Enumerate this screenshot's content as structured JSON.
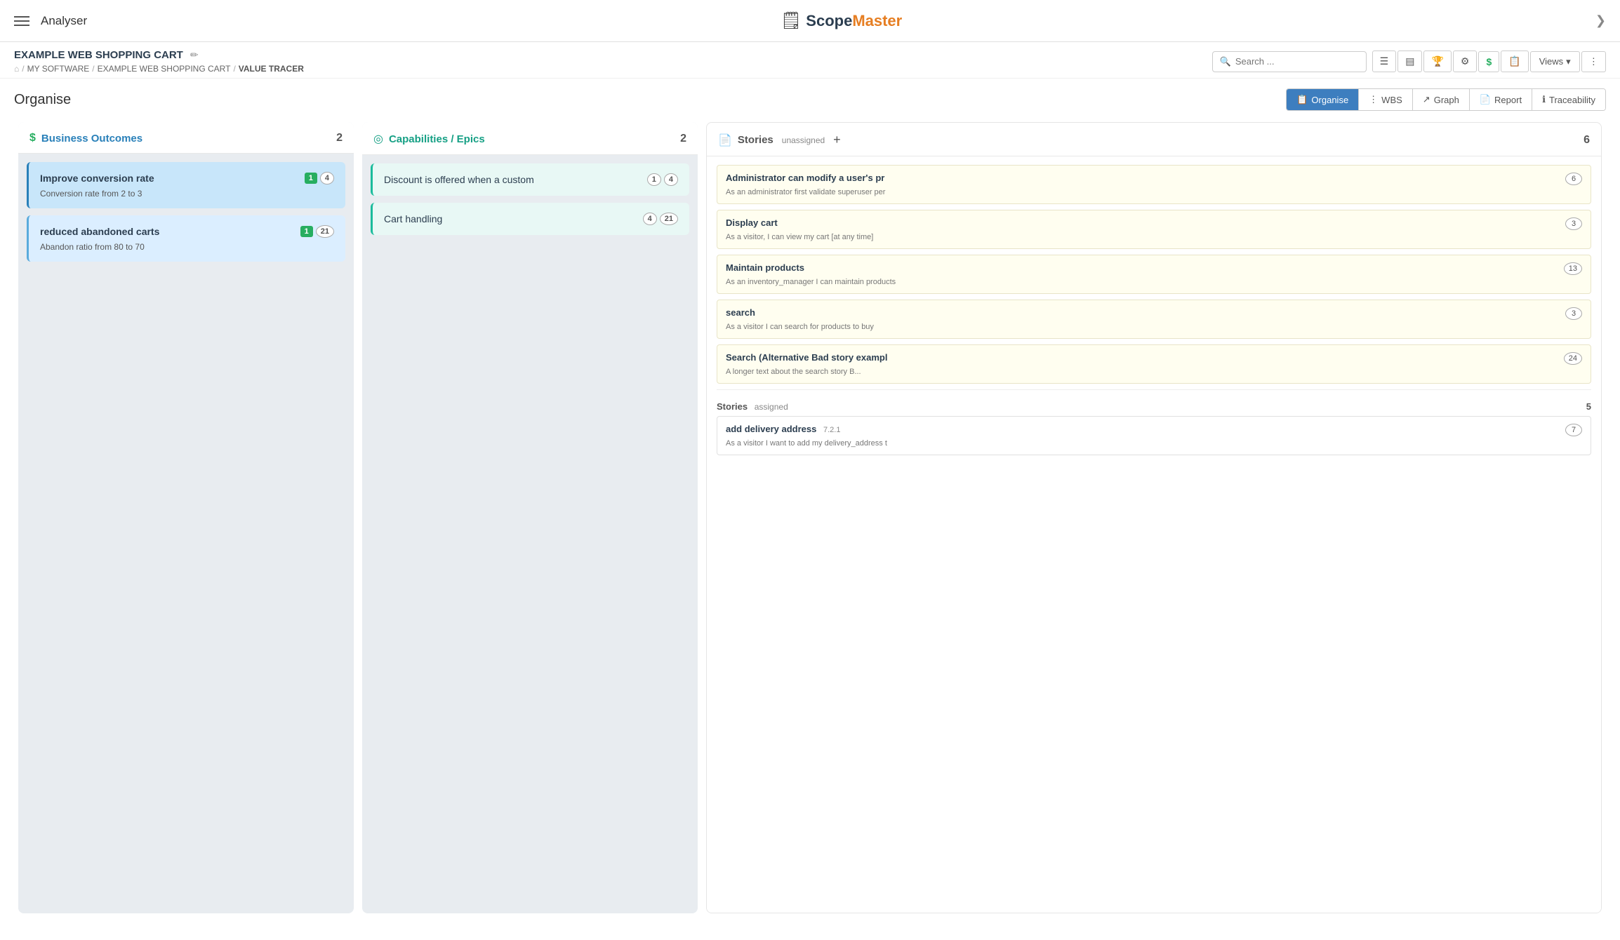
{
  "nav": {
    "hamburger_label": "Menu",
    "analyser_label": "Analyser",
    "brand": "ScopeMaster",
    "brand_prefix": "Scope",
    "brand_suffix": "Master",
    "chevron": "❯"
  },
  "breadcrumb": {
    "project_title": "EXAMPLE WEB SHOPPING CART",
    "edit_icon": "✏",
    "home_icon": "⌂",
    "path": [
      {
        "label": "MY SOFTWARE",
        "sep": "/"
      },
      {
        "label": "EXAMPLE WEB SHOPPING CART",
        "sep": "/"
      },
      {
        "label": "VALUE TRACER",
        "sep": ""
      }
    ]
  },
  "search": {
    "placeholder": "Search ..."
  },
  "toolbar": {
    "buttons": [
      {
        "icon": "☰",
        "label": "list-icon"
      },
      {
        "icon": "▤",
        "label": "grid-icon"
      },
      {
        "icon": "🏆",
        "label": "trophy-icon"
      },
      {
        "icon": "⚙",
        "label": "gear-icon"
      },
      {
        "icon": "$",
        "label": "dollar-icon"
      },
      {
        "icon": "📋",
        "label": "report-icon"
      }
    ],
    "views_label": "Views",
    "more_icon": "⋮"
  },
  "main": {
    "title": "Organise",
    "tabs": [
      {
        "label": "Organise",
        "icon": "📋",
        "active": true
      },
      {
        "label": "WBS",
        "icon": "⋮"
      },
      {
        "label": "Graph",
        "icon": "↗"
      },
      {
        "label": "Report",
        "icon": "📄"
      },
      {
        "label": "Traceability",
        "icon": "ℹ"
      }
    ]
  },
  "business_outcomes": {
    "title": "Business Outcomes",
    "icon": "$",
    "count": 2,
    "cards": [
      {
        "title": "Improve conversion rate",
        "description": "Conversion rate from 2 to 3",
        "badge_green": "1",
        "badge_outline": "4",
        "selected": true
      },
      {
        "title": "reduced abandoned carts",
        "description": "Abandon ratio from 80 to 70",
        "badge_green": "1",
        "badge_outline": "21",
        "selected": false
      }
    ]
  },
  "capabilities": {
    "title": "Capabilities / Epics",
    "icon": "◎",
    "count": 2,
    "cards": [
      {
        "title": "Discount is offered when a custom",
        "badge1": "1",
        "badge2": "4"
      },
      {
        "title": "Cart handling",
        "badge1": "4",
        "badge2": "21"
      }
    ]
  },
  "stories": {
    "title": "Stories",
    "unassigned_label": "unassigned",
    "add_icon": "+",
    "unassigned_count": 6,
    "assigned_label": "assigned",
    "assigned_count": 5,
    "unassigned_stories": [
      {
        "title": "Administrator can modify a user's pr",
        "description": "As an administrator first validate superuser per",
        "badge": "6"
      },
      {
        "title": "Display cart",
        "description": "As a visitor, I can view my cart [at any time]",
        "badge": "3"
      },
      {
        "title": "Maintain products",
        "description": "As an inventory_manager I can maintain products",
        "badge": "13"
      },
      {
        "title": "search",
        "description": "As a visitor I can search for products to buy",
        "badge": "3"
      },
      {
        "title": "Search (Alternative Bad story exampl",
        "description": "A longer text about the search story B...",
        "badge": "24"
      }
    ],
    "assigned_stories": [
      {
        "title": "add delivery address",
        "version": "7.2.1",
        "description": "As a visitor I want to add my delivery_address t",
        "badge": "7"
      }
    ]
  }
}
